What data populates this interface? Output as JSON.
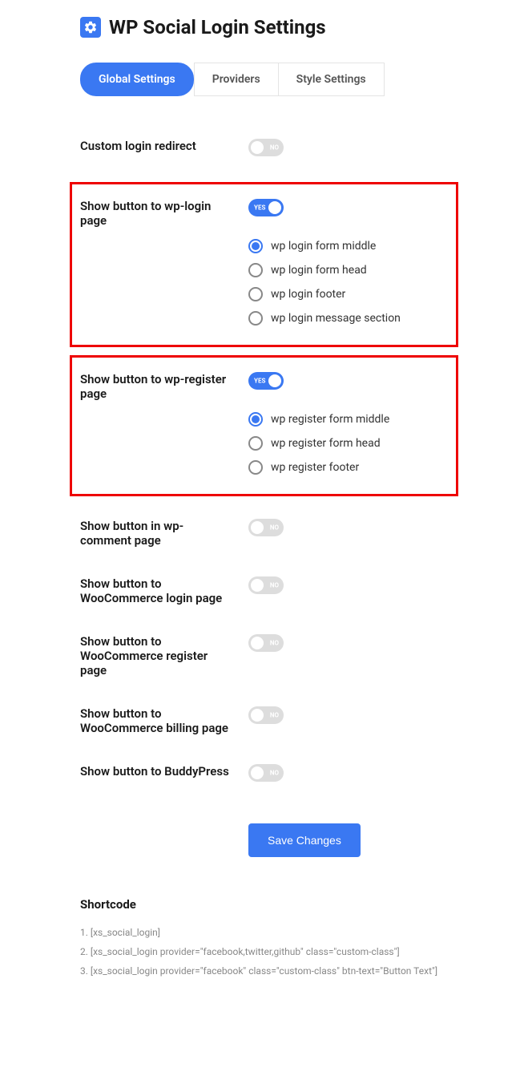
{
  "header": {
    "title": "WP Social Login Settings"
  },
  "tabs": [
    {
      "label": "Global Settings",
      "active": true
    },
    {
      "label": "Providers",
      "active": false
    },
    {
      "label": "Style Settings",
      "active": false
    }
  ],
  "toggle_labels": {
    "on": "YES",
    "off": "NO"
  },
  "settings": {
    "custom_redirect": {
      "label": "Custom login redirect",
      "on": false
    },
    "wp_login": {
      "label": "Show button to wp-login page",
      "on": true,
      "options": [
        {
          "label": "wp login form middle",
          "checked": true
        },
        {
          "label": "wp login form head",
          "checked": false
        },
        {
          "label": "wp login footer",
          "checked": false
        },
        {
          "label": "wp login message section",
          "checked": false
        }
      ]
    },
    "wp_register": {
      "label": "Show button to wp-register page",
      "on": true,
      "options": [
        {
          "label": "wp register form middle",
          "checked": true
        },
        {
          "label": "wp register form head",
          "checked": false
        },
        {
          "label": "wp register footer",
          "checked": false
        }
      ]
    },
    "wp_comment": {
      "label": "Show button in wp-comment page",
      "on": false
    },
    "woo_login": {
      "label": "Show button to WooCommerce login page",
      "on": false
    },
    "woo_register": {
      "label": "Show button to WooCommerce register page",
      "on": false
    },
    "woo_billing": {
      "label": "Show button to WooCommerce billing page",
      "on": false
    },
    "buddypress": {
      "label": "Show button to BuddyPress",
      "on": false
    }
  },
  "save_button": "Save Changes",
  "shortcode": {
    "title": "Shortcode",
    "items": [
      "1. [xs_social_login]",
      "2. [xs_social_login provider=\"facebook,twitter,github\" class=\"custom-class\"]",
      "3. [xs_social_login provider=\"facebook\" class=\"custom-class\" btn-text=\"Button Text\"]"
    ]
  }
}
